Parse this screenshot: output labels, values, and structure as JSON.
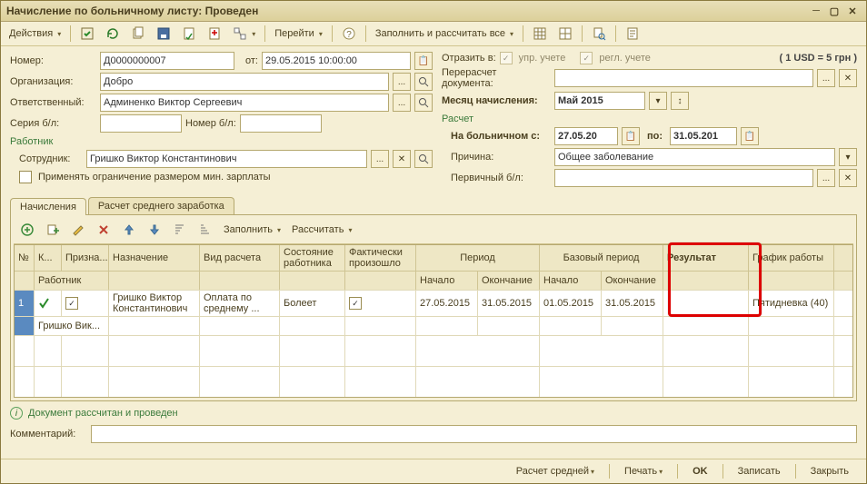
{
  "window": {
    "title": "Начисление по больничному листу: Проведен"
  },
  "toolbar": {
    "actions": "Действия",
    "goto": "Перейти",
    "fillcalc": "Заполнить и рассчитать все"
  },
  "left": {
    "number_label": "Номер:",
    "number": "Д0000000007",
    "from_label": "от:",
    "date": "29.05.2015 10:00:00",
    "org_label": "Организация:",
    "org": "Добро",
    "resp_label": "Ответственный:",
    "resp": "Админенко Виктор Сергеевич",
    "series_label": "Серия б/л:",
    "numbl_label": "Номер б/л:",
    "worker_section": "Работник",
    "employee_label": "Сотрудник:",
    "employee": "Гришко Виктор Константинович",
    "limit_label": "Применять ограничение размером мин. зарплаты"
  },
  "right": {
    "reflect_label": "Отразить в:",
    "upr": "упр. учете",
    "regl": "регл. учете",
    "currency": "( 1 USD = 5 грн )",
    "recalc_label": "Перерасчет документа:",
    "month_label": "Месяц начисления:",
    "month": "Май 2015",
    "calc_section": "Расчет",
    "sick_from_label": "На больничном с:",
    "sick_from": "27.05.20",
    "to_label": "по:",
    "sick_to": "31.05.201",
    "reason_label": "Причина:",
    "reason": "Общее заболевание",
    "primary_label": "Первичный б/л:"
  },
  "tabs": {
    "t1": "Начисления",
    "t2": "Расчет среднего заработка"
  },
  "tabtool": {
    "fill": "Заполнить",
    "calc": "Рассчитать"
  },
  "grid": {
    "headers": {
      "num": "№",
      "k": "К...",
      "prizn": "Призна...",
      "nazn": "Назначение",
      "vid": "Вид расчета",
      "sost": "Состояние работника",
      "fakt": "Фактически произошло",
      "period": "Период",
      "start": "Начало",
      "end": "Окончание",
      "base": "Базовый период",
      "bstart": "Начало",
      "bend": "Окончание",
      "result": "Результат",
      "graf": "График работы",
      "worker": "Работник"
    },
    "rows": [
      {
        "num": "1",
        "nazn": "Гришко Виктор Константинович",
        "worker_short": "Гришко Вик...",
        "vid": "Оплата по среднему ...",
        "sost": "Болеет",
        "fakt_checked": true,
        "p_start": "27.05.2015",
        "p_end": "31.05.2015",
        "b_start": "01.05.2015",
        "b_end": "31.05.2015",
        "result": "",
        "graf": "Пятидневка (40)"
      }
    ]
  },
  "status": {
    "text": "Документ рассчитан и проведен"
  },
  "comment_label": "Комментарий:",
  "footer": {
    "avgcalc": "Расчет средней",
    "print": "Печать",
    "ok": "OK",
    "save": "Записать",
    "close": "Закрыть"
  }
}
